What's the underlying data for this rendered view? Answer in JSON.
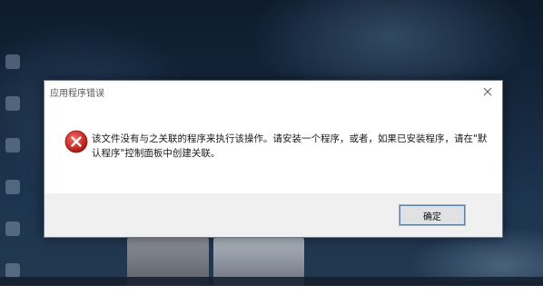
{
  "dialog": {
    "title": "应用程序错误",
    "message": "该文件没有与之关联的程序来执行该操作。请安装一个程序，或者，如果已安装程序，请在\"默认程序\"控制面板中创建关联。",
    "ok_label": "确定",
    "icon": "error-icon",
    "close_icon": "close-icon"
  },
  "colors": {
    "error_red": "#d9322b",
    "button_focus": "#3c8bd8",
    "footer_bg": "#f0f0f0"
  }
}
